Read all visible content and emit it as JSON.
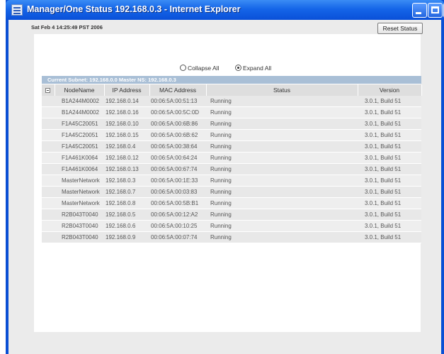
{
  "window": {
    "title": "Manager/One Status 192.168.0.3 - Internet Explorer"
  },
  "status": {
    "timestamp": "Sat Feb 4 14:25:49 PST 2006",
    "reset_label": "Reset Status"
  },
  "view": {
    "collapse_label": "Collapse All",
    "expand_label": "Expand All",
    "selected": "Expand All"
  },
  "subnet": {
    "label": "Current Subnet: 192.168.0.0 Master NS: 192.168.0.3"
  },
  "table": {
    "columns": [
      "",
      "NodeName",
      "IP Address",
      "MAC Address",
      "Status",
      "Version"
    ],
    "rows": [
      {
        "node": "B1A244M0002",
        "ip": "192.168.0.14",
        "mac": "00:06:5A:00:51:13",
        "status": "Running",
        "version": "3.0.1, Build 51"
      },
      {
        "node": "B1A244M0002",
        "ip": "192.168.0.16",
        "mac": "00:06:5A:00:5C:0D",
        "status": "Running",
        "version": "3.0.1, Build 51"
      },
      {
        "node": "F1A45C20051",
        "ip": "192.168.0.10",
        "mac": "00:06:5A:00:6B:86",
        "status": "Running",
        "version": "3.0.1, Build 51"
      },
      {
        "node": "F1A45C20051",
        "ip": "192.168.0.15",
        "mac": "00:06:5A:00:6B:62",
        "status": "Running",
        "version": "3.0.1, Build 51"
      },
      {
        "node": "F1A45C20051",
        "ip": "192.168.0.4",
        "mac": "00:06:5A:00:38:64",
        "status": "Running",
        "version": "3.0.1, Build 51"
      },
      {
        "node": "F1A461K0064",
        "ip": "192.168.0.12",
        "mac": "00:06:5A:00:64:24",
        "status": "Running",
        "version": "3.0.1, Build 51"
      },
      {
        "node": "F1A461K0064",
        "ip": "192.168.0.13",
        "mac": "00:06:5A:00:67:74",
        "status": "Running",
        "version": "3.0.1, Build 51"
      },
      {
        "node": "MasterNetwork",
        "ip": "192.168.0.3",
        "mac": "00:06:5A:00:1E:33",
        "status": "Running",
        "version": "3.0.1, Build 51"
      },
      {
        "node": "MasterNetwork",
        "ip": "192.168.0.7",
        "mac": "00:06:5A:00:03:83",
        "status": "Running",
        "version": "3.0.1, Build 51"
      },
      {
        "node": "MasterNetwork",
        "ip": "192.168.0.8",
        "mac": "00:06:5A:00:5B:B1",
        "status": "Running",
        "version": "3.0.1, Build 51"
      },
      {
        "node": "R2B043T0040",
        "ip": "192.168.0.5",
        "mac": "00:06:5A:00:12:A2",
        "status": "Running",
        "version": "3.0.1, Build 51"
      },
      {
        "node": "R2B043T0040",
        "ip": "192.168.0.6",
        "mac": "00:06:5A:00:10:25",
        "status": "Running",
        "version": "3.0.1, Build 51"
      },
      {
        "node": "R2B043T0040",
        "ip": "192.168.0.9",
        "mac": "00:06:5A:00:07:74",
        "status": "Running",
        "version": "3.0.1, Build 51"
      }
    ]
  }
}
